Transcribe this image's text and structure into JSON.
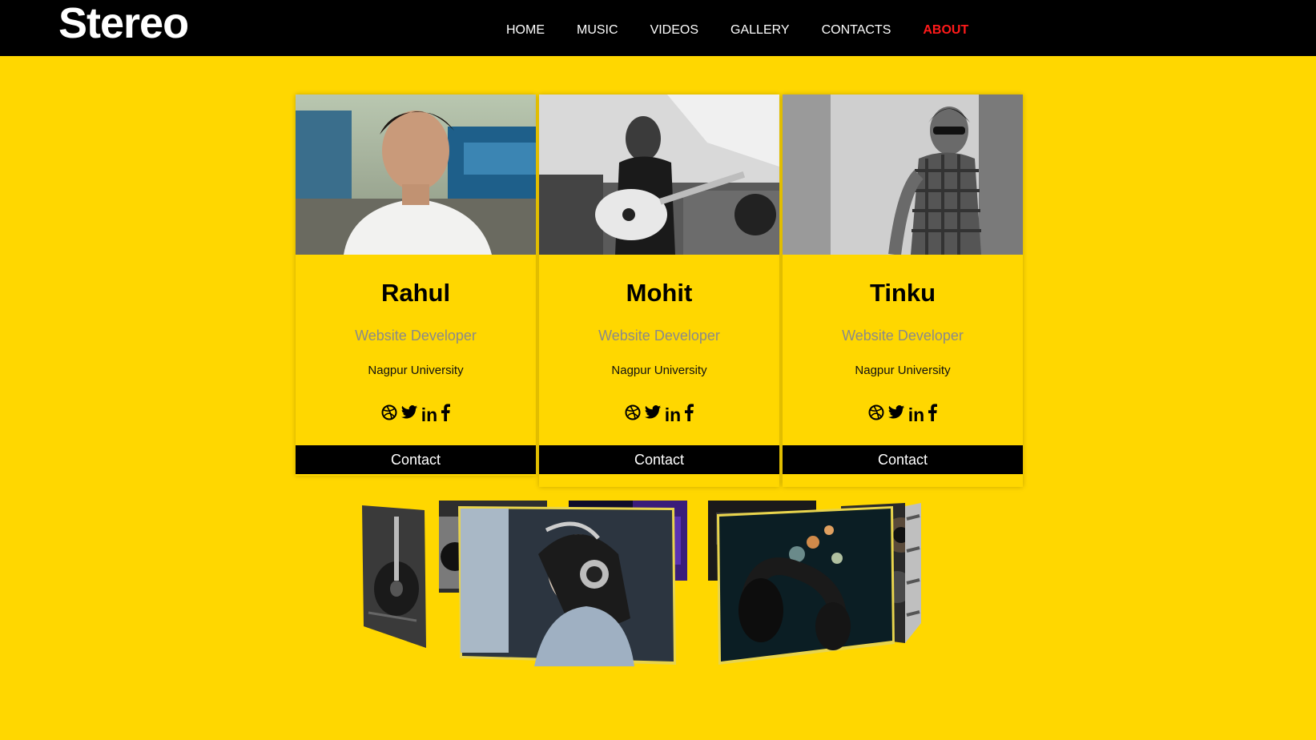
{
  "header": {
    "logo": "Stereo",
    "nav": [
      {
        "label": "HOME"
      },
      {
        "label": "MUSIC"
      },
      {
        "label": "VIDEOS"
      },
      {
        "label": "GALLERY"
      },
      {
        "label": "CONTACTS"
      },
      {
        "label": "ABOUT",
        "active": true
      }
    ]
  },
  "team": [
    {
      "name": "Rahul",
      "role": "Website Developer",
      "school": "Nagpur University",
      "contact_label": "Contact",
      "photo": "portrait-photo-rahul"
    },
    {
      "name": "Mohit",
      "role": "Website Developer",
      "school": "Nagpur University",
      "contact_label": "Contact",
      "photo": "guitar-player-photo-mohit"
    },
    {
      "name": "Tinku",
      "role": "Website Developer",
      "school": "Nagpur University",
      "contact_label": "Contact",
      "photo": "bw-portrait-photo-tinku"
    }
  ],
  "social_icons": [
    "dribbble-icon",
    "twitter-icon",
    "linkedin-icon",
    "facebook-icon"
  ],
  "carousel": {
    "slides": [
      "guitar-photo",
      "studio-photo",
      "purple-stage-photo",
      "headphones-girl-photo",
      "dark-studio-photo",
      "headphones-bokeh-photo",
      "speaker-photo"
    ]
  },
  "colors": {
    "background": "#ffd700",
    "header": "#000000",
    "active_nav": "#ff1a1a",
    "role_text": "#8a8a8a"
  }
}
